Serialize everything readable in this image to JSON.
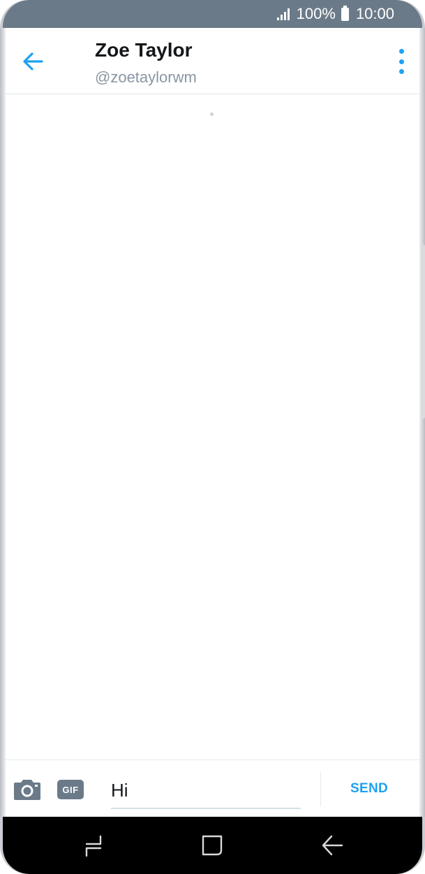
{
  "status_bar": {
    "battery_percent": "100%",
    "time": "10:00"
  },
  "header": {
    "name": "Zoe Taylor",
    "handle": "@zoetaylorwm"
  },
  "composer": {
    "gif_label": "GIF",
    "input_value": "Hi",
    "send_label": "SEND"
  },
  "colors": {
    "accent": "#1da1f2",
    "status_bar": "#6b7a88"
  },
  "icons": {
    "back": "arrow-left-icon",
    "more": "more-vertical-icon",
    "camera": "camera-icon",
    "nav_recent": "recent-apps-icon",
    "nav_home": "home-icon",
    "nav_back": "back-icon"
  }
}
